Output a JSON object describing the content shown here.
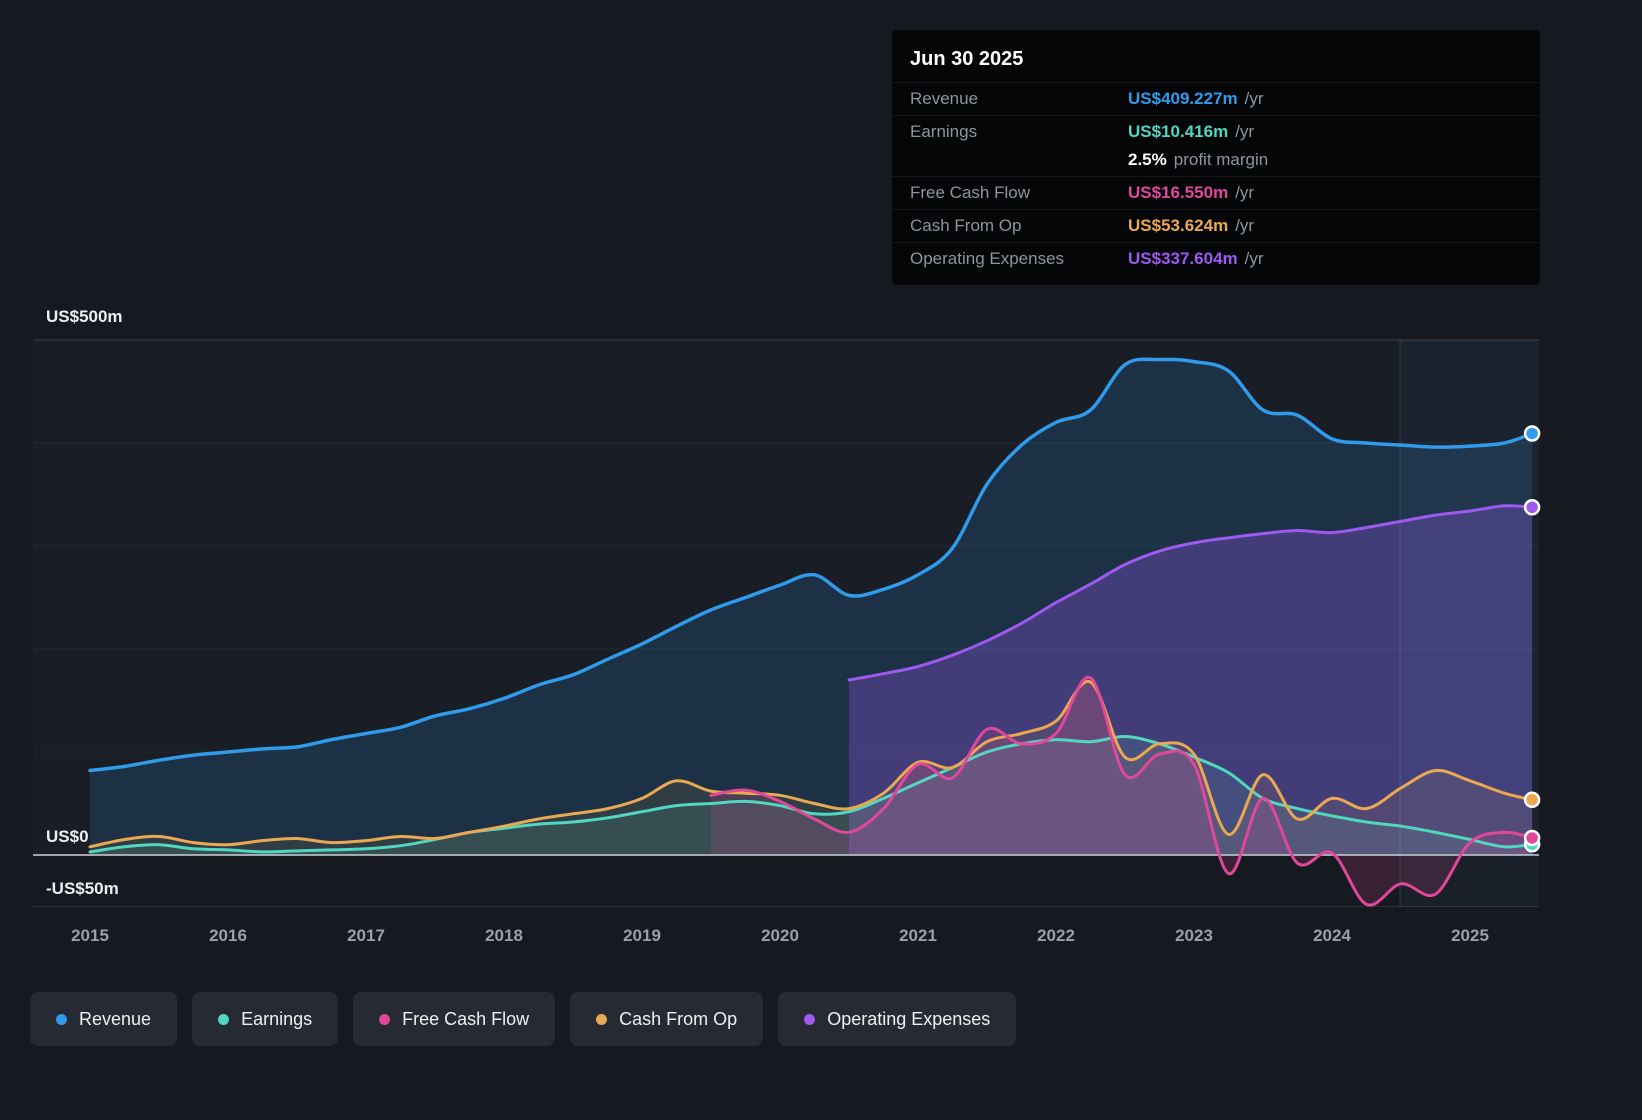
{
  "colors": {
    "revenue": "#2f9bea",
    "earnings": "#52d7bf",
    "free_cash_flow": "#e0489a",
    "cash_from_op": "#e9a851",
    "operating_expenses": "#9d59f0",
    "white": "#ffffff"
  },
  "tooltip": {
    "date": "Jun 30 2025",
    "rows": [
      {
        "label": "Revenue",
        "value": "US$409.227m",
        "suffix": "/yr",
        "color_key": "revenue"
      },
      {
        "label": "Earnings",
        "value": "US$10.416m",
        "suffix": "/yr",
        "color_key": "earnings"
      },
      {
        "label": "",
        "value": "2.5%",
        "suffix": "profit margin",
        "color_key": "white"
      },
      {
        "label": "Free Cash Flow",
        "value": "US$16.550m",
        "suffix": "/yr",
        "color_key": "free_cash_flow"
      },
      {
        "label": "Cash From Op",
        "value": "US$53.624m",
        "suffix": "/yr",
        "color_key": "cash_from_op"
      },
      {
        "label": "Operating Expenses",
        "value": "US$337.604m",
        "suffix": "/yr",
        "color_key": "operating_expenses"
      }
    ]
  },
  "axes": {
    "y_labels": [
      {
        "text": "US$500m",
        "value": 500
      },
      {
        "text": "US$0",
        "value": 0
      },
      {
        "text": "-US$50m",
        "value": -50
      }
    ],
    "x_labels": [
      "2015",
      "2016",
      "2017",
      "2018",
      "2019",
      "2020",
      "2021",
      "2022",
      "2023",
      "2024",
      "2025"
    ]
  },
  "legend": [
    {
      "label": "Revenue",
      "color_key": "revenue"
    },
    {
      "label": "Earnings",
      "color_key": "earnings"
    },
    {
      "label": "Free Cash Flow",
      "color_key": "free_cash_flow"
    },
    {
      "label": "Cash From Op",
      "color_key": "cash_from_op"
    },
    {
      "label": "Operating Expenses",
      "color_key": "operating_expenses"
    }
  ],
  "chart_data": {
    "type": "area",
    "title": "",
    "x_unit": "year",
    "ylim": [
      -75,
      520
    ],
    "y_gridlines": [
      500,
      400,
      300,
      200,
      100,
      0,
      -50
    ],
    "x_ticks": [
      2015,
      2016,
      2017,
      2018,
      2019,
      2020,
      2021,
      2022,
      2023,
      2024,
      2025
    ],
    "legend_position": "bottom",
    "series": [
      {
        "name": "Revenue",
        "color_key": "revenue",
        "x": [
          2015,
          2015.25,
          2015.5,
          2015.75,
          2016,
          2016.25,
          2016.5,
          2016.75,
          2017,
          2017.25,
          2017.5,
          2017.75,
          2018,
          2018.25,
          2018.5,
          2018.75,
          2019,
          2019.25,
          2019.5,
          2019.75,
          2020,
          2020.25,
          2020.5,
          2020.75,
          2021,
          2021.25,
          2021.5,
          2021.75,
          2022,
          2022.25,
          2022.5,
          2022.75,
          2023,
          2023.25,
          2023.5,
          2023.75,
          2024,
          2024.25,
          2024.5,
          2024.75,
          2025,
          2025.25,
          2025.45
        ],
        "values": [
          82,
          86,
          92,
          97,
          100,
          103,
          105,
          112,
          118,
          124,
          135,
          142,
          152,
          165,
          175,
          190,
          205,
          222,
          238,
          250,
          262,
          272,
          252,
          258,
          272,
          298,
          360,
          398,
          420,
          432,
          476,
          481,
          479,
          470,
          432,
          427,
          404,
          400,
          398,
          396,
          397,
          400,
          409.227
        ]
      },
      {
        "name": "Operating Expenses",
        "color_key": "operating_expenses",
        "x": [
          2020.5,
          2020.75,
          2021,
          2021.25,
          2021.5,
          2021.75,
          2022,
          2022.25,
          2022.5,
          2022.75,
          2023,
          2023.25,
          2023.5,
          2023.75,
          2024,
          2024.25,
          2024.5,
          2024.75,
          2025,
          2025.25,
          2025.45
        ],
        "values": [
          170,
          176,
          183,
          194,
          208,
          225,
          245,
          263,
          282,
          295,
          303,
          308,
          312,
          315,
          313,
          318,
          324,
          330,
          334,
          339,
          337.604
        ]
      },
      {
        "name": "Earnings",
        "color_key": "earnings",
        "x": [
          2015,
          2015.25,
          2015.5,
          2015.75,
          2016,
          2016.25,
          2016.5,
          2016.75,
          2017,
          2017.25,
          2017.5,
          2017.75,
          2018,
          2018.25,
          2018.5,
          2018.75,
          2019,
          2019.25,
          2019.5,
          2019.75,
          2020,
          2020.25,
          2020.5,
          2020.75,
          2021,
          2021.25,
          2021.5,
          2021.75,
          2022,
          2022.25,
          2022.5,
          2022.75,
          2023,
          2023.25,
          2023.5,
          2023.75,
          2024,
          2024.25,
          2024.5,
          2024.75,
          2025,
          2025.25,
          2025.45
        ],
        "values": [
          3,
          8,
          10,
          6,
          5,
          3,
          4,
          5,
          6,
          9,
          15,
          22,
          26,
          30,
          32,
          36,
          42,
          48,
          50,
          52,
          48,
          40,
          42,
          55,
          70,
          85,
          100,
          108,
          112,
          110,
          115,
          108,
          95,
          80,
          55,
          45,
          38,
          32,
          28,
          22,
          15,
          8,
          10.416
        ]
      },
      {
        "name": "Cash From Op",
        "color_key": "cash_from_op",
        "x": [
          2015,
          2015.25,
          2015.5,
          2015.75,
          2016,
          2016.25,
          2016.5,
          2016.75,
          2017,
          2017.25,
          2017.5,
          2017.75,
          2018,
          2018.25,
          2018.5,
          2018.75,
          2019,
          2019.25,
          2019.5,
          2019.75,
          2020,
          2020.25,
          2020.5,
          2020.75,
          2021,
          2021.25,
          2021.5,
          2021.75,
          2022,
          2022.25,
          2022.5,
          2022.75,
          2023,
          2023.25,
          2023.5,
          2023.75,
          2024,
          2024.25,
          2024.5,
          2024.75,
          2025,
          2025.25,
          2025.45
        ],
        "values": [
          8,
          15,
          18,
          12,
          10,
          14,
          16,
          12,
          14,
          18,
          16,
          22,
          28,
          35,
          40,
          45,
          55,
          72,
          62,
          60,
          58,
          50,
          45,
          60,
          90,
          85,
          110,
          118,
          130,
          168,
          95,
          108,
          98,
          20,
          78,
          35,
          55,
          45,
          65,
          82,
          72,
          60,
          53.624
        ]
      },
      {
        "name": "Free Cash Flow",
        "color_key": "free_cash_flow",
        "x": [
          2019.5,
          2019.75,
          2020,
          2020.25,
          2020.5,
          2020.75,
          2021,
          2021.25,
          2021.5,
          2021.75,
          2022,
          2022.25,
          2022.5,
          2022.75,
          2023,
          2023.25,
          2023.5,
          2023.75,
          2024,
          2024.25,
          2024.5,
          2024.75,
          2025,
          2025.25,
          2025.45
        ],
        "values": [
          58,
          63,
          52,
          35,
          22,
          45,
          88,
          75,
          122,
          108,
          118,
          172,
          78,
          98,
          88,
          -18,
          55,
          -8,
          2,
          -48,
          -28,
          -38,
          12,
          22,
          16.55
        ]
      }
    ]
  }
}
